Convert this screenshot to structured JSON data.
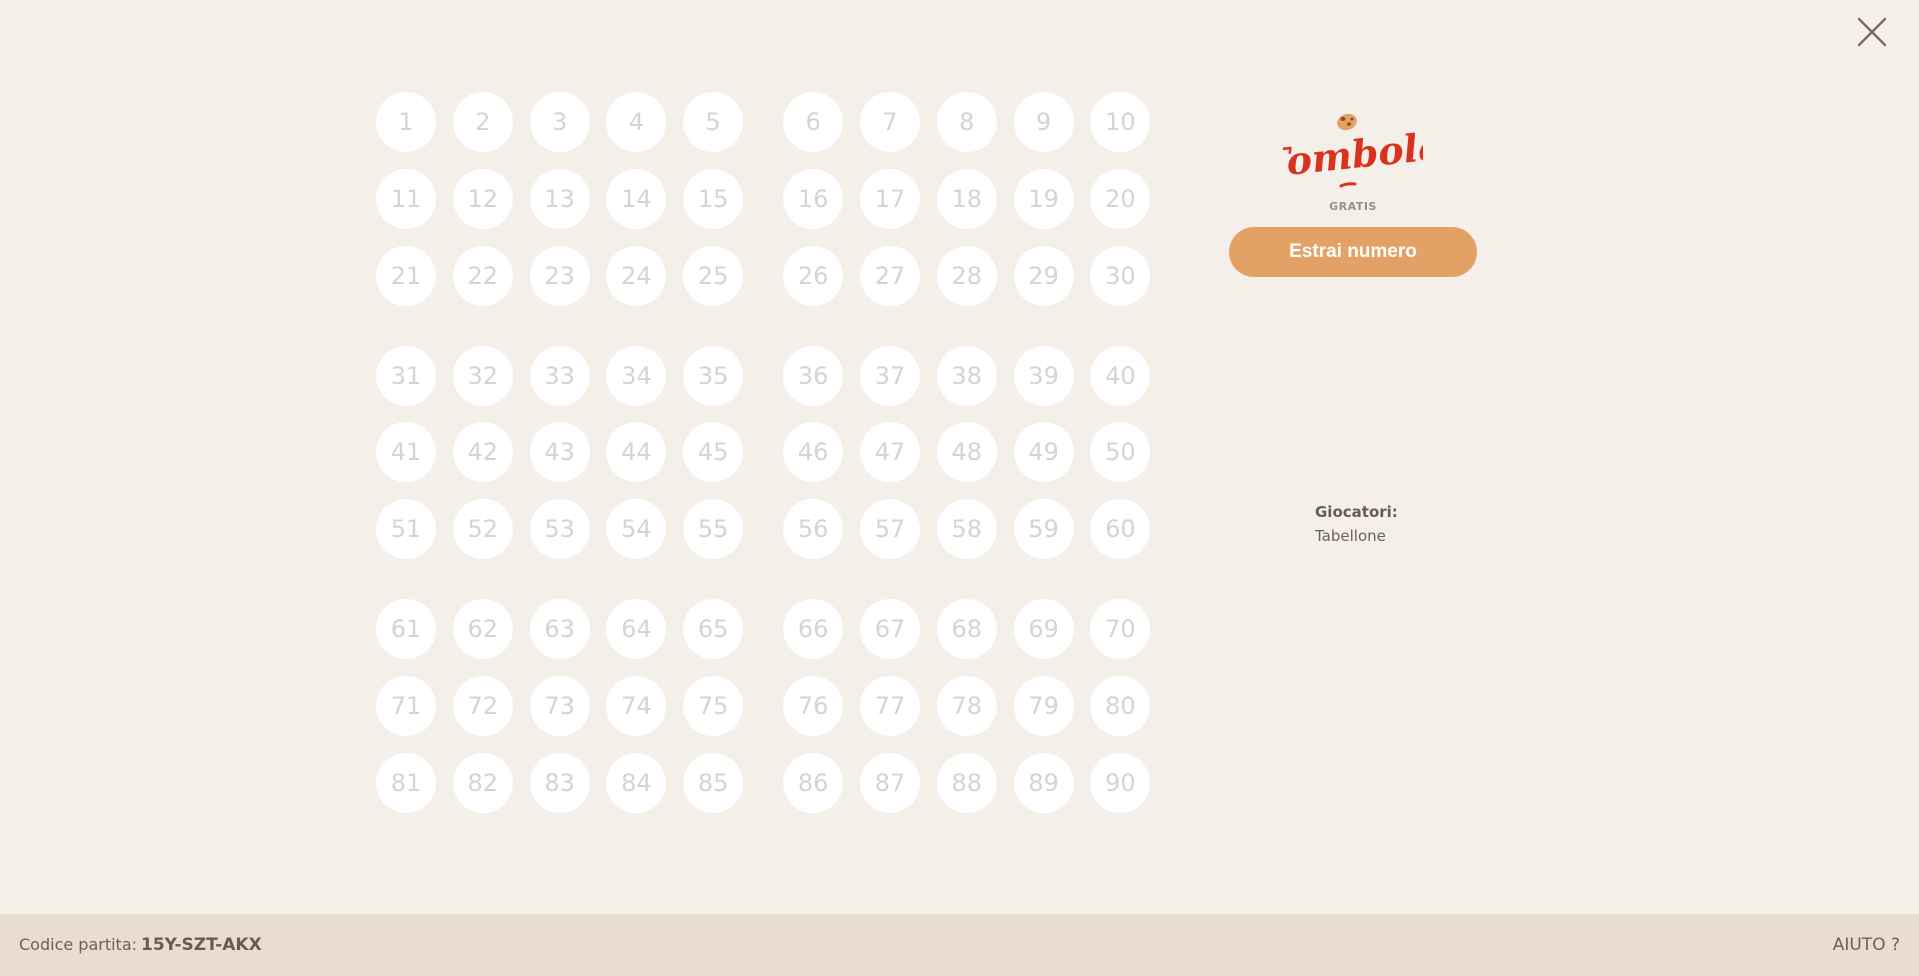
{
  "board": {
    "blocks": [
      [
        1,
        2,
        3,
        4,
        5,
        11,
        12,
        13,
        14,
        15,
        21,
        22,
        23,
        24,
        25
      ],
      [
        6,
        7,
        8,
        9,
        10,
        16,
        17,
        18,
        19,
        20,
        26,
        27,
        28,
        29,
        30
      ],
      [
        31,
        32,
        33,
        34,
        35,
        41,
        42,
        43,
        44,
        45,
        51,
        52,
        53,
        54,
        55
      ],
      [
        36,
        37,
        38,
        39,
        40,
        46,
        47,
        48,
        49,
        50,
        56,
        57,
        58,
        59,
        60
      ],
      [
        61,
        62,
        63,
        64,
        65,
        71,
        72,
        73,
        74,
        75,
        81,
        82,
        83,
        84,
        85
      ],
      [
        66,
        67,
        68,
        69,
        70,
        76,
        77,
        78,
        79,
        80,
        86,
        87,
        88,
        89,
        90
      ]
    ]
  },
  "logo": {
    "wordmark": "Tombola",
    "subtitle": "GRATIS"
  },
  "draw_button": {
    "label": "Estrai numero"
  },
  "players": {
    "label": "Giocatori:",
    "value": "Tabellone"
  },
  "footer": {
    "code_label": "Codice partita:",
    "code_value": "15Y-SZT-AKX",
    "help_label": "AIUTO ?"
  },
  "icons": {
    "close": "close-icon",
    "logo": "tombola-logo"
  },
  "colors": {
    "background": "#f4efe9",
    "button": "#e3a265",
    "logo_red": "#d9321e",
    "footer": "#e9ddd3"
  }
}
